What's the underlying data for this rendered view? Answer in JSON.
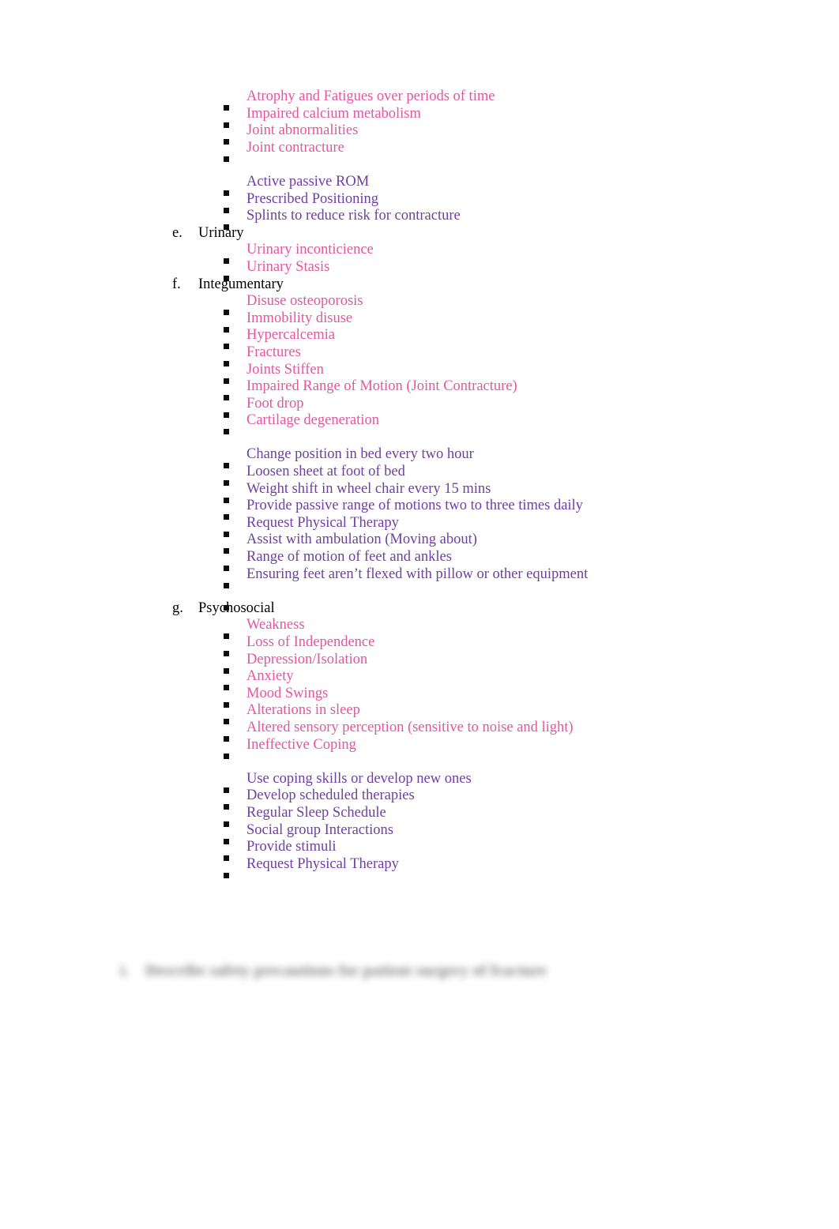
{
  "document": {
    "background_color": "#FFFFFF",
    "symptom_color": "#E3579F",
    "intervention_color": "#6F3FA3",
    "heading_color": "#000000",
    "bullet_glyph": "square-bullet"
  },
  "blocks": [
    {
      "kind": "bullets",
      "group": "musculoskeletal_symptoms",
      "style": "sym",
      "items": [
        "Atrophy and Fatigues over periods of time",
        "Impaired calcium metabolism",
        "Joint abnormalities",
        "Joint contracture"
      ]
    },
    {
      "kind": "spacer"
    },
    {
      "kind": "bullets",
      "group": "musculoskeletal_interventions",
      "style": "intv",
      "items": [
        "Active passive ROM",
        "Prescribed Positioning",
        "Splints to reduce risk for contracture"
      ]
    },
    {
      "kind": "lettered",
      "marker": "e.",
      "label": "Urinary"
    },
    {
      "kind": "bullets",
      "group": "urinary_symptoms",
      "style": "sym",
      "items": [
        "Urinary inconticience",
        "Urinary Stasis"
      ]
    },
    {
      "kind": "lettered",
      "marker": "f.",
      "label": "Integumentary"
    },
    {
      "kind": "bullets",
      "group": "integumentary_symptoms",
      "style": "sym",
      "items": [
        "Disuse osteoporosis",
        "Immobility disuse",
        "Hypercalcemia",
        "Fractures",
        "Joints Stiffen",
        "Impaired Range of Motion (Joint Contracture)",
        "Foot drop",
        "Cartilage degeneration"
      ]
    },
    {
      "kind": "spacer"
    },
    {
      "kind": "bullets",
      "group": "integumentary_interventions",
      "style": "intv",
      "items": [
        "Change position in bed every two hour",
        "Loosen sheet at foot of bed",
        "Weight shift in wheel chair every 15 mins",
        "Provide passive range of motions two to three times daily",
        "Request Physical Therapy",
        "Assist with ambulation (Moving about)",
        "Range of motion of feet and ankles",
        "Ensuring feet aren’t flexed with pillow or other equipment",
        ""
      ]
    },
    {
      "kind": "lettered",
      "marker": "g.",
      "label": "Psychosocial"
    },
    {
      "kind": "bullets",
      "group": "psychosocial_symptoms",
      "style": "sym",
      "items": [
        "Weakness",
        "Loss of Independence",
        "Depression/Isolation",
        "Anxiety",
        "Mood Swings",
        "Alterations in sleep",
        "Altered sensory perception (sensitive to noise and light)",
        "Ineffective Coping"
      ]
    },
    {
      "kind": "spacer"
    },
    {
      "kind": "bullets",
      "group": "psychosocial_interventions",
      "style": "intv",
      "items": [
        "Use coping skills or develop new ones",
        "Develop scheduled therapies",
        "Regular Sleep Schedule",
        "Social group Interactions",
        "Provide stimuli",
        "Request Physical Therapy"
      ]
    }
  ],
  "redacted_heading": {
    "marker": "i.",
    "text": "Describe safety precautions for patient surgery of fracture"
  }
}
